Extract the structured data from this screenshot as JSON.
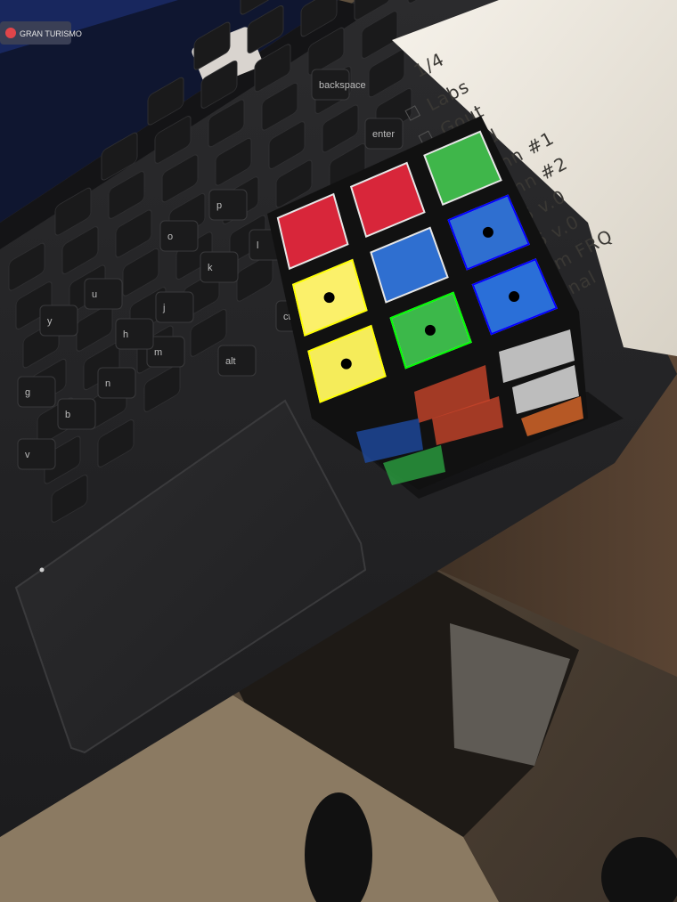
{
  "laptop": {
    "screen_tab_text": "GRAN TURISMO",
    "keyboard": {
      "keys": [
        {
          "label": "backspace"
        },
        {
          "label": "enter"
        },
        {
          "label": "p"
        },
        {
          "label": "l"
        },
        {
          "label": "o"
        },
        {
          "label": "k"
        },
        {
          "label": "m"
        },
        {
          "label": "n"
        },
        {
          "label": "j"
        },
        {
          "label": "h"
        },
        {
          "label": "b"
        },
        {
          "label": "g"
        },
        {
          "label": "v"
        },
        {
          "label": "y"
        },
        {
          "label": "u"
        },
        {
          "label": "alt"
        },
        {
          "label": "ctrl"
        }
      ]
    }
  },
  "note": {
    "header": "1/4",
    "lines": [
      "Labs",
      "Gout",
      "Read",
      "UPenn #1",
      "UPenn #2",
      "14.6 v.0",
      "14.6 v.0",
      "Chem FRQ",
      "Journal"
    ]
  },
  "cube": {
    "top_face": [
      [
        "#d8263a",
        "#d8263a",
        "#3fb64a"
      ],
      [
        "#fbf06a",
        "#2f6fd0",
        "#2f6fd0"
      ],
      [
        "#f5ec5a",
        "#3cb84a",
        "#2a6fd8"
      ]
    ],
    "annotated_stickers": [
      {
        "color": "yellow",
        "outline": "#ffff00"
      },
      {
        "color": "yellow",
        "outline": "#ffff00"
      },
      {
        "color": "green",
        "outline": "#00ff00"
      },
      {
        "color": "blue",
        "outline": "#0000ff"
      },
      {
        "color": "blue",
        "outline": "#0000ff"
      }
    ],
    "side_colors": [
      "#c8452a",
      "#e8e8e8",
      "#e06a2a",
      "#1e4aa0",
      "#2aa040"
    ]
  }
}
